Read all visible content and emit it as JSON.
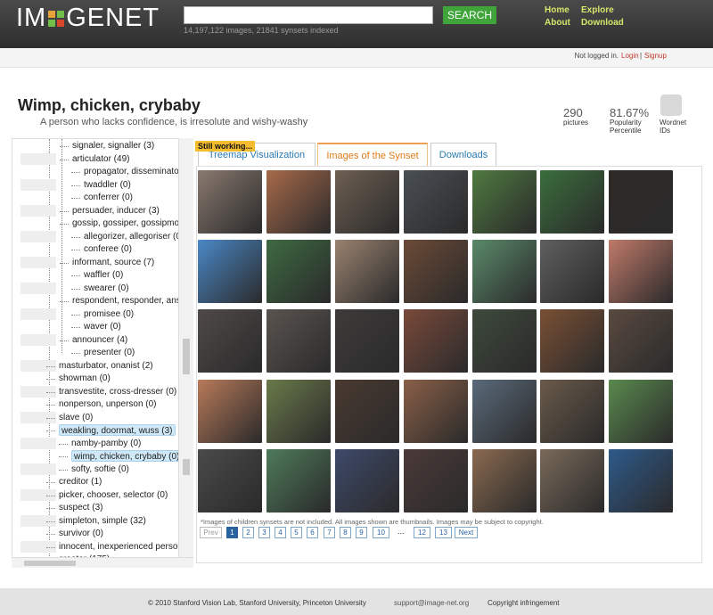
{
  "header": {
    "logo_left": "IM",
    "logo_right": "GENET",
    "search_placeholder": "",
    "search_button": "SEARCH",
    "stats": "14,197,122 images, 21841 synsets indexed",
    "nav": [
      "Home",
      "Explore",
      "About",
      "Download"
    ]
  },
  "user": {
    "status": "Not logged in.",
    "login": "Login",
    "sep": "|",
    "signup": "Signup"
  },
  "synset": {
    "title": "Wimp, chicken, crybaby",
    "gloss": "A person who lacks confidence, is irresolute and wishy-washy",
    "pictures_value": "290",
    "pictures_label": "pictures",
    "popularity_value": "81.67%",
    "popularity_label1": "Popularity",
    "popularity_label2": "Percentile",
    "wordnet_label1": "Wordnet",
    "wordnet_label2": "IDs"
  },
  "tree": {
    "items": [
      "signaler, signaller (3)",
      "articulator (49)",
      "propagator, disseminator (0)",
      "twaddler (0)",
      "conferrer (0)",
      "persuader, inducer (3)",
      "gossip, gossiper, gossipmon",
      "allegorizer, allegoriser (0)",
      "conferee (0)",
      "informant, source (7)",
      "waffler (0)",
      "swearer (0)",
      "respondent, responder, answ",
      "promisee (0)",
      "waver (0)",
      "announcer (4)",
      "presenter (0)",
      "masturbator, onanist (2)",
      "showman (0)",
      "transvestite, cross-dresser (0)",
      "nonperson, unperson (0)",
      "slave (0)",
      "weakling, doormat, wuss (3)",
      "namby-pamby (0)",
      "wimp, chicken, crybaby (0)",
      "softy, softie (0)",
      "creditor (1)",
      "picker, chooser, selector (0)",
      "suspect (3)",
      "simpleton, simple (32)",
      "survivor (0)",
      "innocent, inexperienced person",
      "creator (175)"
    ]
  },
  "loading": "Still working...",
  "tabs": [
    "Treemap Visualization",
    "Images of the Synset",
    "Downloads"
  ],
  "thumb_colors": [
    "#8a7a70",
    "#a86a4a",
    "#6e5f52",
    "#4a4f55",
    "#4f7a40",
    "#3a6e3c",
    "#2e2a28",
    "#4a88c6",
    "#3e6a42",
    "#9a8270",
    "#6b4a36",
    "#5a8a6a",
    "#5f5f5f",
    "#c07a6a",
    "#4f4a48",
    "#5a5450",
    "#3e3a3a",
    "#7a4a3a",
    "#3e4a3c",
    "#7a5034",
    "#5a4a40",
    "#b87a5a",
    "#6a7a4a",
    "#4a3a30",
    "#8a6048",
    "#5a6a7a",
    "#6a5a4a",
    "#5a8a4e",
    "#4a4a4a",
    "#4e7a5a",
    "#3e4a6a",
    "#4a3a38",
    "#8a6a50",
    "#7a6a5a",
    "#2e5a8a"
  ],
  "note": "*Images of children synsets are not included. All images shown are thumbnails. Images may be subject to copyright.",
  "pager": {
    "prev": "Prev",
    "pages": [
      "1",
      "2",
      "3",
      "4",
      "5",
      "6",
      "7",
      "8",
      "9",
      "10"
    ],
    "ellipsis": "...",
    "last": [
      "12",
      "13"
    ],
    "next": "Next"
  },
  "footer": {
    "copyright": "© 2010 Stanford Vision Lab, Stanford University, Princeton University",
    "email": "support@image-net.org",
    "link": "Copyright infringement"
  }
}
